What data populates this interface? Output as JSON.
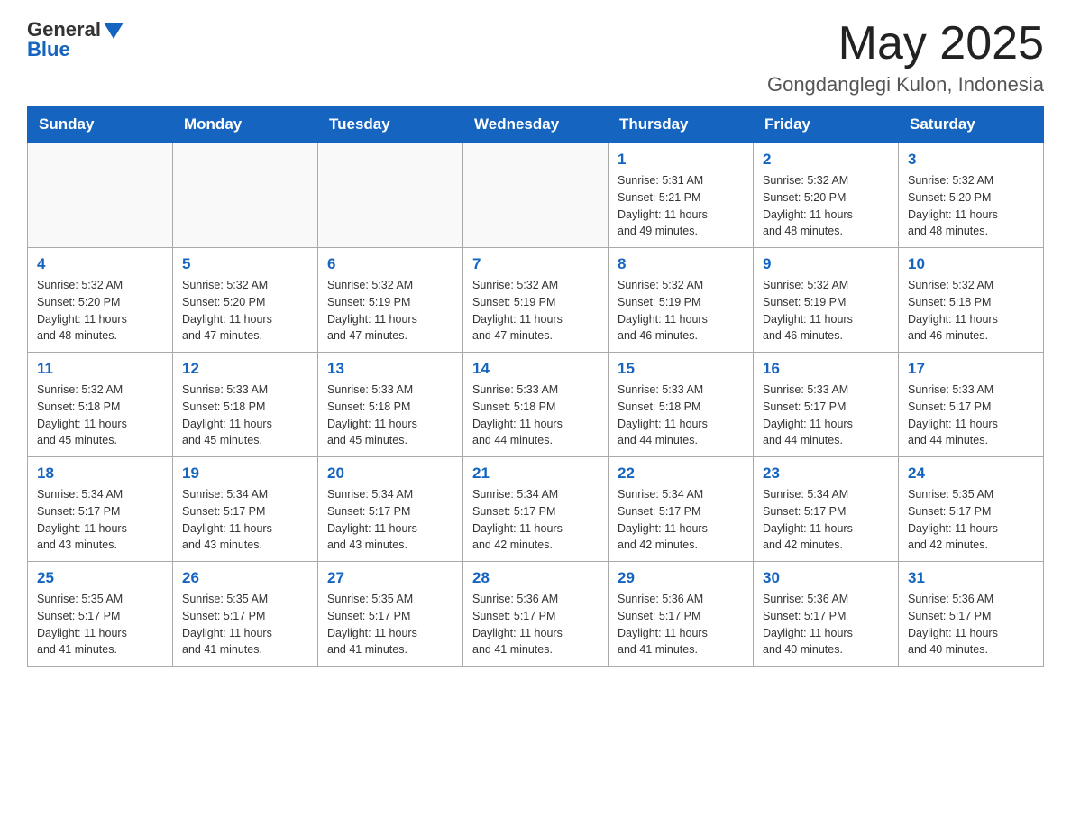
{
  "header": {
    "logo_general": "General",
    "logo_blue": "Blue",
    "month_title": "May 2025",
    "location": "Gongdanglegi Kulon, Indonesia"
  },
  "days_of_week": [
    "Sunday",
    "Monday",
    "Tuesday",
    "Wednesday",
    "Thursday",
    "Friday",
    "Saturday"
  ],
  "weeks": [
    [
      {
        "day": "",
        "info": ""
      },
      {
        "day": "",
        "info": ""
      },
      {
        "day": "",
        "info": ""
      },
      {
        "day": "",
        "info": ""
      },
      {
        "day": "1",
        "info": "Sunrise: 5:31 AM\nSunset: 5:21 PM\nDaylight: 11 hours\nand 49 minutes."
      },
      {
        "day": "2",
        "info": "Sunrise: 5:32 AM\nSunset: 5:20 PM\nDaylight: 11 hours\nand 48 minutes."
      },
      {
        "day": "3",
        "info": "Sunrise: 5:32 AM\nSunset: 5:20 PM\nDaylight: 11 hours\nand 48 minutes."
      }
    ],
    [
      {
        "day": "4",
        "info": "Sunrise: 5:32 AM\nSunset: 5:20 PM\nDaylight: 11 hours\nand 48 minutes."
      },
      {
        "day": "5",
        "info": "Sunrise: 5:32 AM\nSunset: 5:20 PM\nDaylight: 11 hours\nand 47 minutes."
      },
      {
        "day": "6",
        "info": "Sunrise: 5:32 AM\nSunset: 5:19 PM\nDaylight: 11 hours\nand 47 minutes."
      },
      {
        "day": "7",
        "info": "Sunrise: 5:32 AM\nSunset: 5:19 PM\nDaylight: 11 hours\nand 47 minutes."
      },
      {
        "day": "8",
        "info": "Sunrise: 5:32 AM\nSunset: 5:19 PM\nDaylight: 11 hours\nand 46 minutes."
      },
      {
        "day": "9",
        "info": "Sunrise: 5:32 AM\nSunset: 5:19 PM\nDaylight: 11 hours\nand 46 minutes."
      },
      {
        "day": "10",
        "info": "Sunrise: 5:32 AM\nSunset: 5:18 PM\nDaylight: 11 hours\nand 46 minutes."
      }
    ],
    [
      {
        "day": "11",
        "info": "Sunrise: 5:32 AM\nSunset: 5:18 PM\nDaylight: 11 hours\nand 45 minutes."
      },
      {
        "day": "12",
        "info": "Sunrise: 5:33 AM\nSunset: 5:18 PM\nDaylight: 11 hours\nand 45 minutes."
      },
      {
        "day": "13",
        "info": "Sunrise: 5:33 AM\nSunset: 5:18 PM\nDaylight: 11 hours\nand 45 minutes."
      },
      {
        "day": "14",
        "info": "Sunrise: 5:33 AM\nSunset: 5:18 PM\nDaylight: 11 hours\nand 44 minutes."
      },
      {
        "day": "15",
        "info": "Sunrise: 5:33 AM\nSunset: 5:18 PM\nDaylight: 11 hours\nand 44 minutes."
      },
      {
        "day": "16",
        "info": "Sunrise: 5:33 AM\nSunset: 5:17 PM\nDaylight: 11 hours\nand 44 minutes."
      },
      {
        "day": "17",
        "info": "Sunrise: 5:33 AM\nSunset: 5:17 PM\nDaylight: 11 hours\nand 44 minutes."
      }
    ],
    [
      {
        "day": "18",
        "info": "Sunrise: 5:34 AM\nSunset: 5:17 PM\nDaylight: 11 hours\nand 43 minutes."
      },
      {
        "day": "19",
        "info": "Sunrise: 5:34 AM\nSunset: 5:17 PM\nDaylight: 11 hours\nand 43 minutes."
      },
      {
        "day": "20",
        "info": "Sunrise: 5:34 AM\nSunset: 5:17 PM\nDaylight: 11 hours\nand 43 minutes."
      },
      {
        "day": "21",
        "info": "Sunrise: 5:34 AM\nSunset: 5:17 PM\nDaylight: 11 hours\nand 42 minutes."
      },
      {
        "day": "22",
        "info": "Sunrise: 5:34 AM\nSunset: 5:17 PM\nDaylight: 11 hours\nand 42 minutes."
      },
      {
        "day": "23",
        "info": "Sunrise: 5:34 AM\nSunset: 5:17 PM\nDaylight: 11 hours\nand 42 minutes."
      },
      {
        "day": "24",
        "info": "Sunrise: 5:35 AM\nSunset: 5:17 PM\nDaylight: 11 hours\nand 42 minutes."
      }
    ],
    [
      {
        "day": "25",
        "info": "Sunrise: 5:35 AM\nSunset: 5:17 PM\nDaylight: 11 hours\nand 41 minutes."
      },
      {
        "day": "26",
        "info": "Sunrise: 5:35 AM\nSunset: 5:17 PM\nDaylight: 11 hours\nand 41 minutes."
      },
      {
        "day": "27",
        "info": "Sunrise: 5:35 AM\nSunset: 5:17 PM\nDaylight: 11 hours\nand 41 minutes."
      },
      {
        "day": "28",
        "info": "Sunrise: 5:36 AM\nSunset: 5:17 PM\nDaylight: 11 hours\nand 41 minutes."
      },
      {
        "day": "29",
        "info": "Sunrise: 5:36 AM\nSunset: 5:17 PM\nDaylight: 11 hours\nand 41 minutes."
      },
      {
        "day": "30",
        "info": "Sunrise: 5:36 AM\nSunset: 5:17 PM\nDaylight: 11 hours\nand 40 minutes."
      },
      {
        "day": "31",
        "info": "Sunrise: 5:36 AM\nSunset: 5:17 PM\nDaylight: 11 hours\nand 40 minutes."
      }
    ]
  ]
}
